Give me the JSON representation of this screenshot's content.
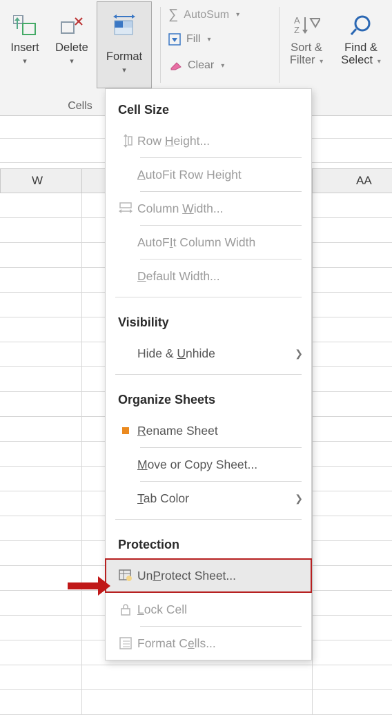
{
  "ribbon": {
    "insert_label": "Insert",
    "delete_label": "Delete",
    "format_label": "Format",
    "autosum_label": "AutoSum",
    "fill_label": "Fill",
    "clear_label": "Clear",
    "sortfilter_line1": "Sort &",
    "sortfilter_line2": "Filter",
    "findselect_line1": "Find &",
    "findselect_line2": "Select",
    "group_cells": "Cells"
  },
  "columns": {
    "w": "W",
    "aa": "AA"
  },
  "menu": {
    "sections": {
      "cell_size": "Cell Size",
      "visibility": "Visibility",
      "organize": "Organize Sheets",
      "protection": "Protection"
    },
    "items": {
      "row_height_pre": "Row ",
      "row_height_key": "H",
      "row_height_post": "eight...",
      "autofit_row": "AutoFit Row Height",
      "autofit_row_key": "A",
      "col_width_pre": "Column ",
      "col_width_key": "W",
      "col_width_post": "idth...",
      "autofit_col": "AutoF",
      "autofit_col_key": "I",
      "autofit_col_post": "t Column Width",
      "default_width_key": "D",
      "default_width_post": "efault Width...",
      "hide_pre": "Hide & ",
      "hide_key": "U",
      "hide_post": "nhide",
      "rename_key": "R",
      "rename_post": "ename Sheet",
      "move_key": "M",
      "move_post": "ove or Copy Sheet...",
      "tab_key": "T",
      "tab_post": "ab Color",
      "unprotect_key": "P",
      "unprotect_pre": "Un",
      "unprotect_post": "rotect Sheet...",
      "lock_key": "L",
      "lock_post": "ock Cell",
      "format_cells_pre": "Format C",
      "format_cells_key": "e",
      "format_cells_post": "lls..."
    }
  }
}
